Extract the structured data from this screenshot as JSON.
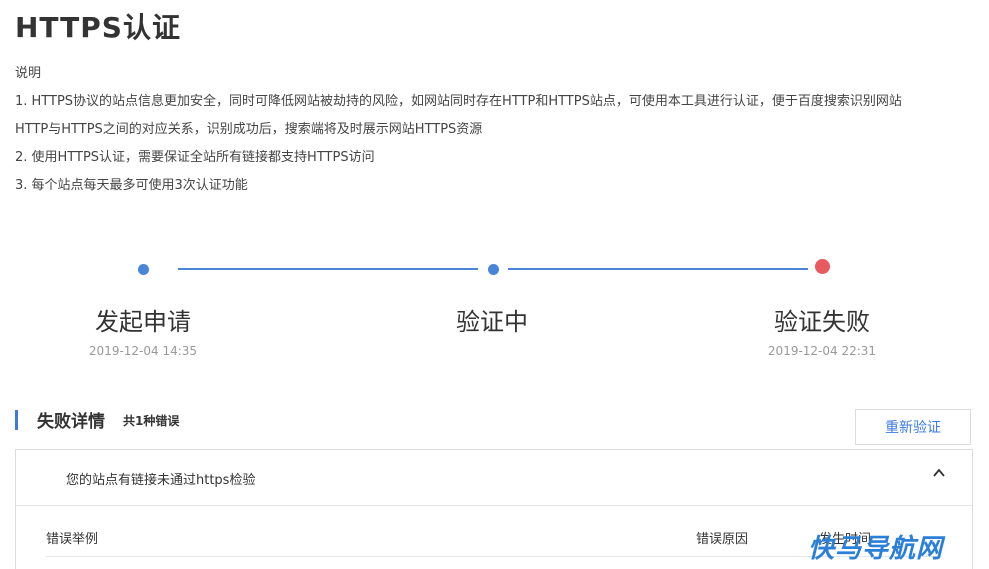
{
  "page_title": "HTTPS认证",
  "description": {
    "heading": "说明",
    "lines": [
      "1. HTTPS协议的站点信息更加安全，同时可降低网站被劫持的风险，如网站同时存在HTTP和HTTPS站点，可使用本工具进行认证，便于百度搜索识别网站",
      "HTTP与HTTPS之间的对应关系，识别成功后，搜索端将及时展示网站HTTPS资源",
      "2. 使用HTTPS认证，需要保证全站所有链接都支持HTTPS访问",
      "3. 每个站点每天最多可使用3次认证功能"
    ]
  },
  "steps": [
    {
      "label": "发起申请",
      "time": "2019-12-04 14:35",
      "status": "done",
      "color": "#4a86d8"
    },
    {
      "label": "验证中",
      "time": "",
      "status": "done",
      "color": "#4a86d8"
    },
    {
      "label": "验证失败",
      "time": "2019-12-04 22:31",
      "status": "failed",
      "color": "#e85a5f"
    }
  ],
  "failure": {
    "title": "失败详情",
    "count_text": "共1种错误",
    "retry_label": "重新验证",
    "item_text": "您的站点有链接未通过https检验",
    "columns": [
      "错误举例",
      "错误原因",
      "发生时间"
    ]
  },
  "watermark": "快马导航网",
  "colors": {
    "accent": "#3b7be0",
    "error": "#e85a5f"
  }
}
